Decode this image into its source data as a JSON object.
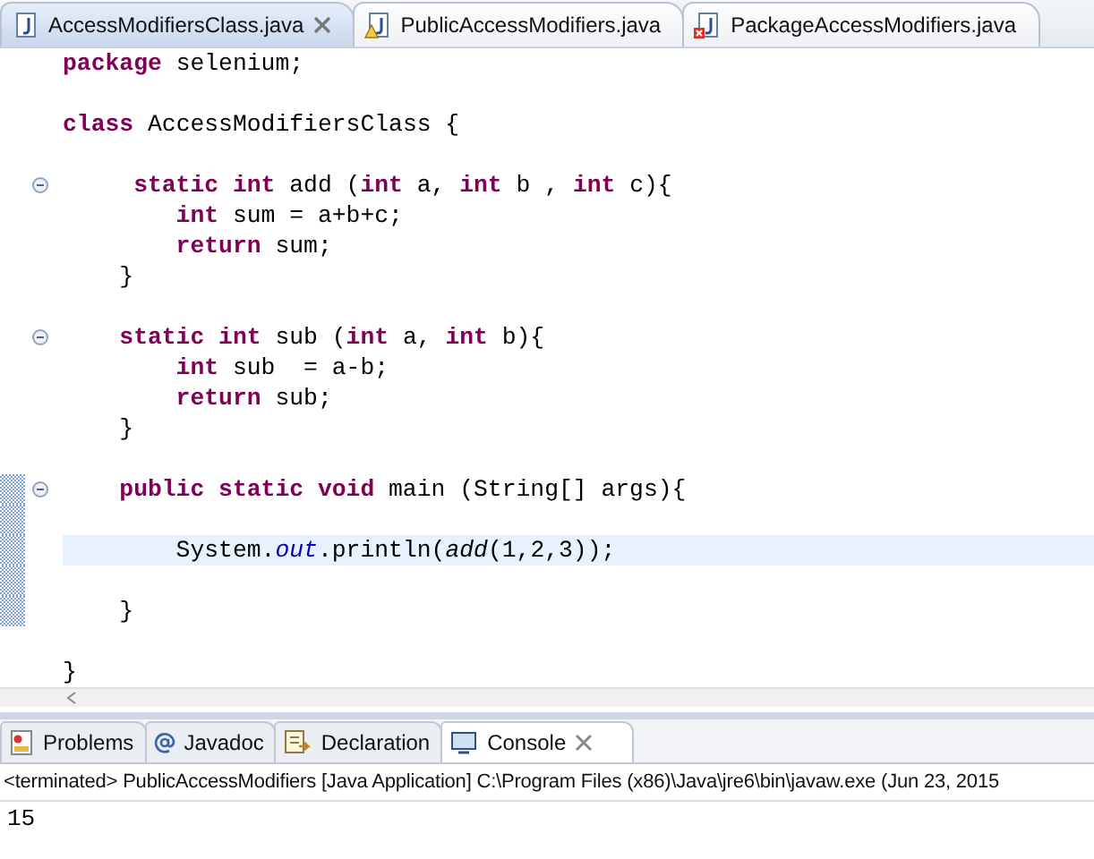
{
  "editor_tabs": [
    {
      "label": "AccessModifiersClass.java",
      "selected": true,
      "warning": false,
      "error": false
    },
    {
      "label": "PublicAccessModifiers.java",
      "selected": false,
      "warning": true,
      "error": false
    },
    {
      "label": "PackageAccessModifiers.java",
      "selected": false,
      "warning": false,
      "error": true
    }
  ],
  "code_lines": [
    {
      "foldable": false,
      "current": false,
      "changed": false,
      "tokens": [
        {
          "kind": "keyword",
          "text": "package"
        },
        {
          "kind": "plain",
          "text": " selenium;"
        }
      ]
    },
    {
      "foldable": false,
      "current": false,
      "changed": false
    },
    {
      "foldable": false,
      "current": false,
      "changed": false,
      "tokens": [
        {
          "kind": "keyword",
          "text": "class"
        },
        {
          "kind": "plain",
          "text": " AccessModifiersClass {"
        }
      ]
    },
    {
      "foldable": false,
      "current": false,
      "changed": false
    },
    {
      "foldable": true,
      "current": false,
      "changed": false,
      "tokens": [
        {
          "kind": "keyword",
          "text": "     static int"
        },
        {
          "kind": "plain",
          "text": " add ("
        },
        {
          "kind": "keyword",
          "text": "int"
        },
        {
          "kind": "plain",
          "text": " a, "
        },
        {
          "kind": "keyword",
          "text": "int"
        },
        {
          "kind": "plain",
          "text": " b , "
        },
        {
          "kind": "keyword",
          "text": "int"
        },
        {
          "kind": "plain",
          "text": " c){"
        }
      ]
    },
    {
      "foldable": false,
      "current": false,
      "changed": false,
      "tokens": [
        {
          "kind": "keyword",
          "text": "        int"
        },
        {
          "kind": "plain",
          "text": " sum = a+b+c;"
        }
      ]
    },
    {
      "foldable": false,
      "current": false,
      "changed": false,
      "tokens": [
        {
          "kind": "keyword",
          "text": "        return"
        },
        {
          "kind": "plain",
          "text": " sum;"
        }
      ]
    },
    {
      "foldable": false,
      "current": false,
      "changed": false,
      "tokens": [
        {
          "kind": "plain",
          "text": "    }"
        }
      ]
    },
    {
      "foldable": false,
      "current": false,
      "changed": false
    },
    {
      "foldable": true,
      "current": false,
      "changed": false,
      "tokens": [
        {
          "kind": "keyword",
          "text": "    static int"
        },
        {
          "kind": "plain",
          "text": " sub ("
        },
        {
          "kind": "keyword",
          "text": "int"
        },
        {
          "kind": "plain",
          "text": " a, "
        },
        {
          "kind": "keyword",
          "text": "int"
        },
        {
          "kind": "plain",
          "text": " b){"
        }
      ]
    },
    {
      "foldable": false,
      "current": false,
      "changed": false,
      "tokens": [
        {
          "kind": "keyword",
          "text": "        int"
        },
        {
          "kind": "plain",
          "text": " sub  = a-b;"
        }
      ]
    },
    {
      "foldable": false,
      "current": false,
      "changed": false,
      "tokens": [
        {
          "kind": "keyword",
          "text": "        return"
        },
        {
          "kind": "plain",
          "text": " sub;"
        }
      ]
    },
    {
      "foldable": false,
      "current": false,
      "changed": false,
      "tokens": [
        {
          "kind": "plain",
          "text": "    }"
        }
      ]
    },
    {
      "foldable": false,
      "current": false,
      "changed": false
    },
    {
      "foldable": true,
      "current": false,
      "changed": true,
      "tokens": [
        {
          "kind": "keyword",
          "text": "    public static void"
        },
        {
          "kind": "plain",
          "text": " main (String[] args){"
        }
      ]
    },
    {
      "foldable": false,
      "current": false,
      "changed": true
    },
    {
      "foldable": false,
      "current": true,
      "changed": true,
      "tokens": [
        {
          "kind": "plain",
          "text": "        System."
        },
        {
          "kind": "field",
          "text": "out"
        },
        {
          "kind": "plain",
          "text": ".println("
        },
        {
          "kind": "method",
          "text": "add"
        },
        {
          "kind": "plain",
          "text": "(1,2,3));"
        }
      ]
    },
    {
      "foldable": false,
      "current": false,
      "changed": true
    },
    {
      "foldable": false,
      "current": false,
      "changed": true,
      "tokens": [
        {
          "kind": "plain",
          "text": "    }"
        }
      ]
    },
    {
      "foldable": false,
      "current": false,
      "changed": false
    },
    {
      "foldable": false,
      "current": false,
      "changed": false,
      "tokens": [
        {
          "kind": "plain",
          "text": "}"
        }
      ]
    }
  ],
  "view_tabs": [
    {
      "label": "Problems",
      "kind": "problems",
      "selected": false
    },
    {
      "label": "Javadoc",
      "kind": "javadoc",
      "selected": false
    },
    {
      "label": "Declaration",
      "kind": "declaration",
      "selected": false
    },
    {
      "label": "Console",
      "kind": "console",
      "selected": true
    }
  ],
  "console": {
    "header": "<terminated> PublicAccessModifiers [Java Application] C:\\Program Files (x86)\\Java\\jre6\\bin\\javaw.exe (Jun 23, 2015",
    "output": "15"
  }
}
